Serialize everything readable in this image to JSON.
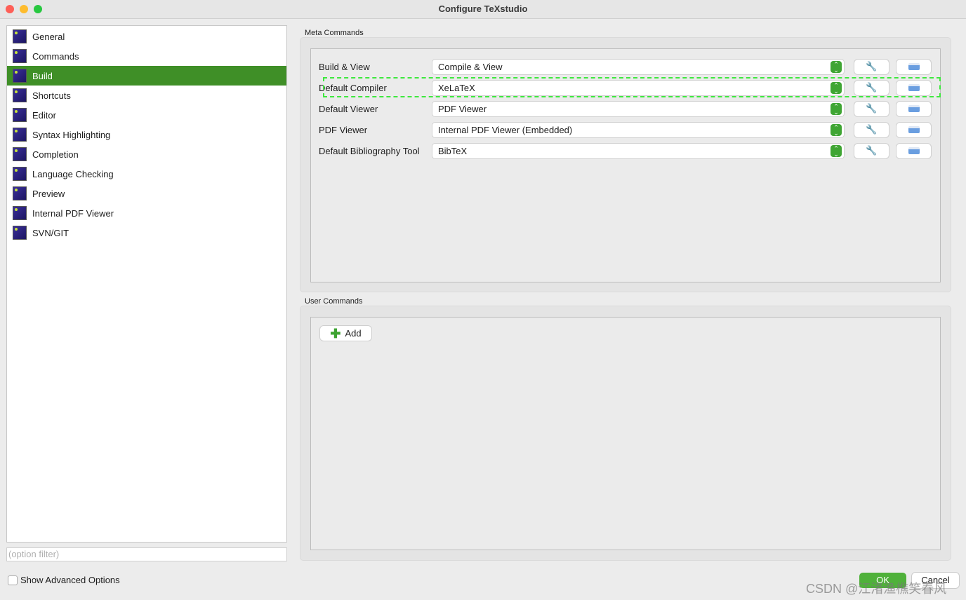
{
  "window": {
    "title": "Configure TeXstudio"
  },
  "sidebar": {
    "items": [
      {
        "label": "General",
        "icon": "TXS"
      },
      {
        "label": "Commands",
        "icon": "latex"
      },
      {
        "label": "Build",
        "icon": "build"
      },
      {
        "label": "Shortcuts",
        "icon": "kbd"
      },
      {
        "label": "Editor",
        "icon": "ed"
      },
      {
        "label": "Syntax Highlighting",
        "icon": "syn"
      },
      {
        "label": "Completion",
        "icon": "cmp"
      },
      {
        "label": "Language Checking",
        "icon": "lang"
      },
      {
        "label": "Preview",
        "icon": "prev"
      },
      {
        "label": "Internal PDF Viewer",
        "icon": "pdf"
      },
      {
        "label": "SVN/GIT",
        "icon": "SVN"
      }
    ],
    "selected": "Build",
    "filter_placeholder": "(option filter)",
    "advanced_label": "Show Advanced Options"
  },
  "meta": {
    "title": "Meta Commands",
    "rows": [
      {
        "label": "Build & View",
        "value": "Compile & View"
      },
      {
        "label": "Default Compiler",
        "value": "XeLaTeX"
      },
      {
        "label": "Default Viewer",
        "value": "PDF Viewer"
      },
      {
        "label": "PDF Viewer",
        "value": "Internal PDF Viewer (Embedded)"
      },
      {
        "label": "Default Bibliography Tool",
        "value": "BibTeX"
      }
    ]
  },
  "user": {
    "title": "User Commands",
    "add_label": "Add"
  },
  "footer": {
    "ok": "OK",
    "cancel": "Cancel"
  },
  "watermark": "CSDN @江渚渔樵笑春风"
}
